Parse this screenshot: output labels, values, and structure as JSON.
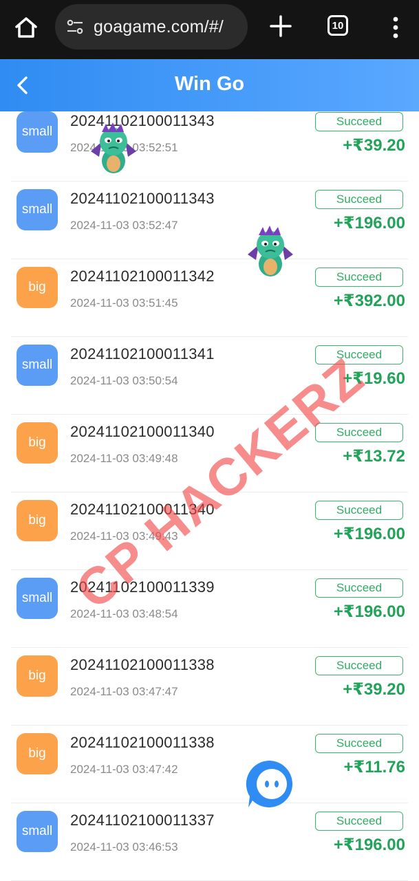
{
  "browser": {
    "url": "goagame.com/#/",
    "tab_count": "10",
    "icons": [
      "home-icon",
      "site-settings-icon",
      "plus-icon",
      "tabs-icon",
      "more-vertical-icon"
    ]
  },
  "header": {
    "title": "Win Go",
    "back_icon": "chevron-left-icon"
  },
  "records": [
    {
      "type": "small",
      "issue": "20241102100011343",
      "time": "2024-11-03 03:52:51",
      "status": "Succeed",
      "amount": "+₹39.20"
    },
    {
      "type": "small",
      "issue": "20241102100011343",
      "time": "2024-11-03 03:52:47",
      "status": "Succeed",
      "amount": "+₹196.00"
    },
    {
      "type": "big",
      "issue": "20241102100011342",
      "time": "2024-11-03 03:51:45",
      "status": "Succeed",
      "amount": "+₹392.00"
    },
    {
      "type": "small",
      "issue": "20241102100011341",
      "time": "2024-11-03 03:50:54",
      "status": "Succeed",
      "amount": "+₹19.60"
    },
    {
      "type": "big",
      "issue": "20241102100011340",
      "time": "2024-11-03 03:49:48",
      "status": "Succeed",
      "amount": "+₹13.72"
    },
    {
      "type": "big",
      "issue": "20241102100011340",
      "time": "2024-11-03 03:49:43",
      "status": "Succeed",
      "amount": "+₹196.00"
    },
    {
      "type": "small",
      "issue": "20241102100011339",
      "time": "2024-11-03 03:48:54",
      "status": "Succeed",
      "amount": "+₹196.00"
    },
    {
      "type": "big",
      "issue": "20241102100011338",
      "time": "2024-11-03 03:47:47",
      "status": "Succeed",
      "amount": "+₹39.20"
    },
    {
      "type": "big",
      "issue": "20241102100011338",
      "time": "2024-11-03 03:47:42",
      "status": "Succeed",
      "amount": "+₹11.76"
    },
    {
      "type": "small",
      "issue": "20241102100011337",
      "time": "2024-11-03 03:46:53",
      "status": "Succeed",
      "amount": "+₹196.00"
    }
  ],
  "watermark": "CP HACKERZ",
  "colors": {
    "header_start": "#2f8cf2",
    "header_end": "#5aa8ff",
    "small_badge": "#5b9cf4",
    "big_badge": "#fba24a",
    "success_green": "#23a35a",
    "watermark_red": "#f04646"
  },
  "overlay_icons": [
    "dragon-sticker-icon",
    "dragon-sticker-icon",
    "chat-bubble-icon"
  ]
}
